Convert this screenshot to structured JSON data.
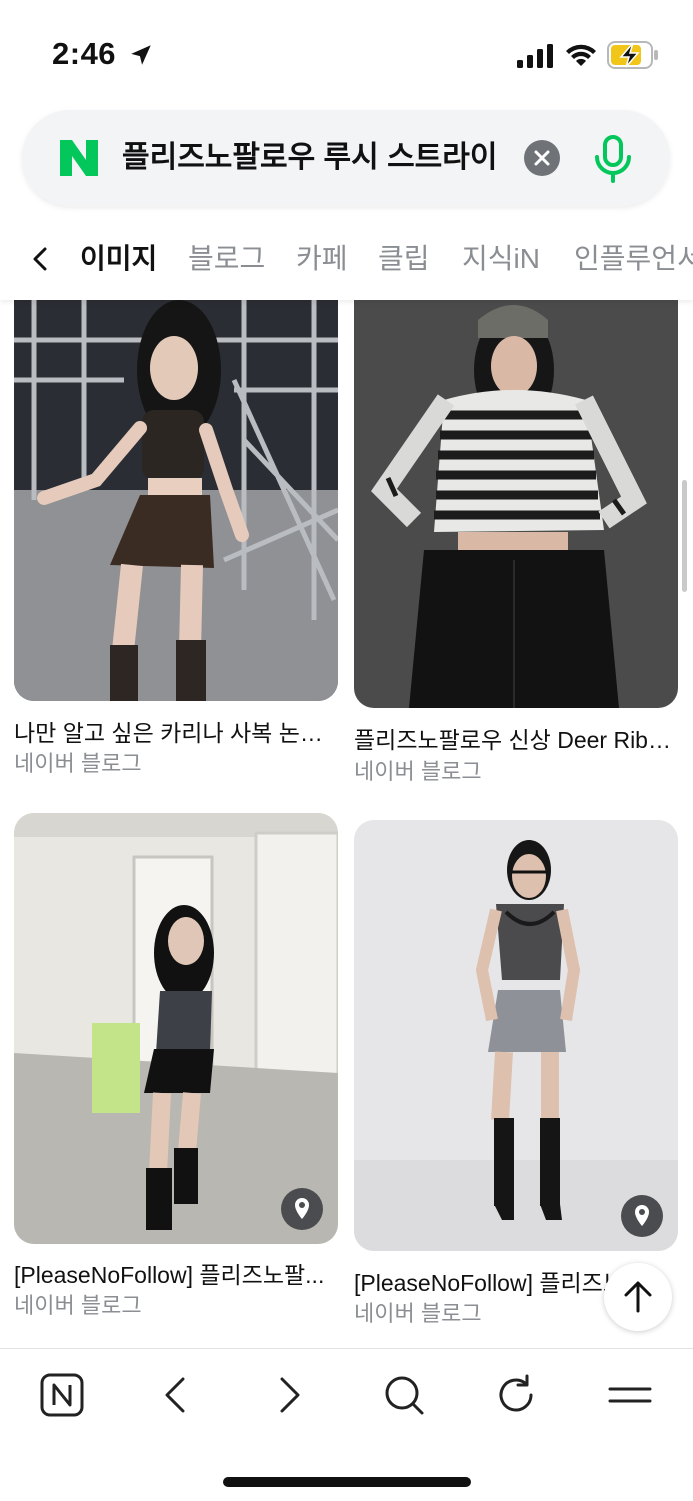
{
  "status_bar": {
    "time": "2:46",
    "icons": [
      "location-arrow-icon",
      "cellular-signal-icon",
      "wifi-icon",
      "battery-charging-icon"
    ]
  },
  "search": {
    "logo": "N",
    "query": "플리즈노팔로우 루시 스트라이",
    "icons": [
      "clear-icon",
      "microphone-icon"
    ],
    "brand_color": "#03c75a"
  },
  "tabs": {
    "items": [
      {
        "label": "이미지",
        "active": true
      },
      {
        "label": "블로그"
      },
      {
        "label": "카페"
      },
      {
        "label": "클립"
      },
      {
        "label": "지식iN"
      },
      {
        "label": "인플루언서"
      }
    ]
  },
  "results": [
    {
      "title": "나만 알고 싶은 카리나 사복 논란,...",
      "source": "네이버 블로그"
    },
    {
      "title": "플리즈노팔로우 신상 Deer Ribb...",
      "source": "네이버 블로그"
    },
    {
      "title": "[PleaseNoFollow] 플리즈노팔...",
      "source": "네이버 블로그",
      "icon": "map-pin-icon"
    },
    {
      "title": "[PleaseNoFollow] 플리즈노팔로우",
      "source": "네이버 블로그",
      "icon": "map-pin-icon"
    }
  ],
  "toolbar": {
    "icons": [
      "naver-home-icon",
      "back-icon",
      "forward-icon",
      "search-icon",
      "refresh-icon",
      "menu-icon"
    ]
  }
}
